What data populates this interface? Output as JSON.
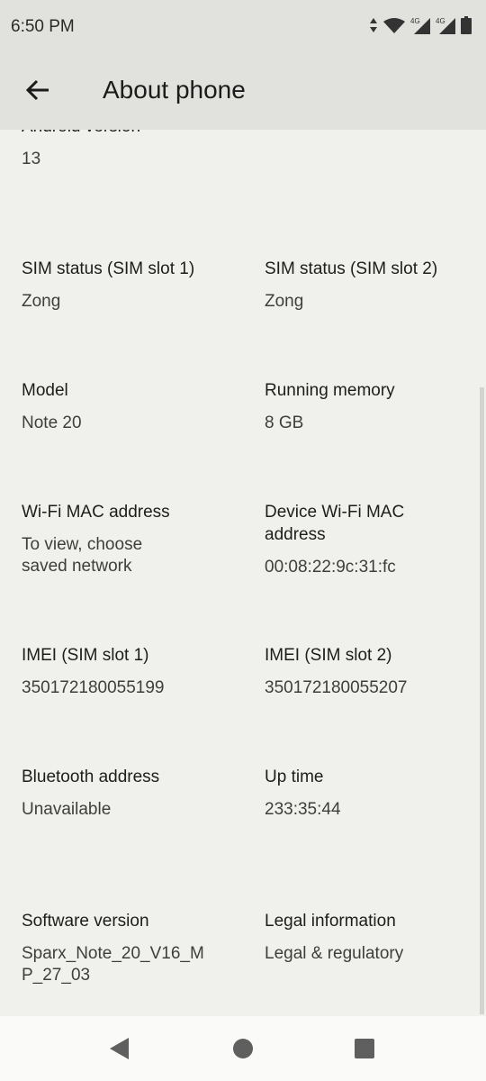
{
  "status_bar": {
    "time": "6:50 PM",
    "icons": [
      "data-arrows-icon",
      "wifi-icon",
      "signal-4g-icon",
      "signal-4g-icon",
      "battery-icon"
    ],
    "network_label_1": "4G",
    "network_label_2": "4G"
  },
  "toolbar": {
    "title": "About phone",
    "back_icon": "arrow-left-icon"
  },
  "items": [
    {
      "title": "Android version",
      "value": "13"
    },
    {
      "title": "SIM status (SIM slot 1)",
      "value": "Zong"
    },
    {
      "title": "SIM status (SIM slot 2)",
      "value": "Zong"
    },
    {
      "title": "Model",
      "value": "Note 20"
    },
    {
      "title": "Running memory",
      "value": "8 GB"
    },
    {
      "title": "Wi-Fi MAC address",
      "value": "To view, choose saved network"
    },
    {
      "title": "Device Wi-Fi MAC address",
      "value": "00:08:22:9c:31:fc"
    },
    {
      "title": "IMEI (SIM slot 1)",
      "value": "350172180055199"
    },
    {
      "title": "IMEI (SIM slot 2)",
      "value": "350172180055207"
    },
    {
      "title": "Bluetooth address",
      "value": "Unavailable"
    },
    {
      "title": "Up time",
      "value": "233:35:44"
    },
    {
      "title": "Software version",
      "value": "Sparx_Note_20_V16_MP_27_03"
    },
    {
      "title": "Legal information",
      "value": "Legal & regulatory"
    }
  ],
  "colors": {
    "header": "#e1e2dd",
    "background": "#f0f1ec",
    "nav_bar": "#fafaf8"
  }
}
